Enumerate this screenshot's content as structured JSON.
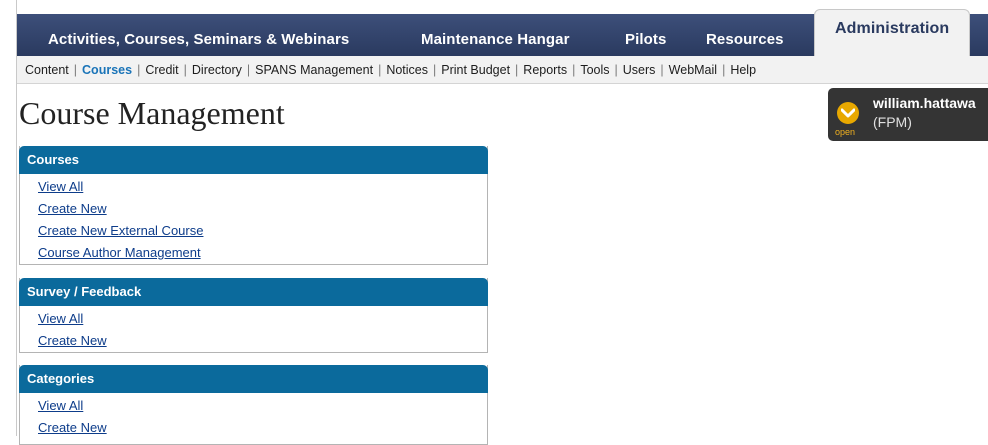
{
  "top_nav": {
    "tabs": [
      {
        "label": "Activities, Courses, Seminars & Webinars"
      },
      {
        "label": "Maintenance Hangar"
      },
      {
        "label": "Pilots"
      },
      {
        "label": "Resources"
      },
      {
        "label": "Administration",
        "active": true
      }
    ]
  },
  "sub_nav": {
    "items": [
      "Content",
      "Courses",
      "Credit",
      "Directory",
      "SPANS Management",
      "Notices",
      "Print Budget",
      "Reports",
      "Tools",
      "Users",
      "WebMail",
      "Help"
    ],
    "separator": "|",
    "current": "Courses"
  },
  "page": {
    "title": "Course Management"
  },
  "user": {
    "name": "william.hattawa",
    "role": "(FPM)",
    "status_label": "open"
  },
  "panels": {
    "courses": {
      "title": "Courses",
      "links": [
        "View All",
        "Create New",
        "Create New External Course",
        "Course Author Management"
      ]
    },
    "survey": {
      "title": "Survey / Feedback",
      "links": [
        "View All",
        "Create New"
      ]
    },
    "categories": {
      "title": "Categories",
      "links": [
        "View All",
        "Create New"
      ]
    }
  },
  "colors": {
    "nav_bg": "#2a3a5f",
    "panel_header": "#0b6a9c",
    "link": "#0d3c8a",
    "current_subnav": "#1a74b8",
    "badge_accent": "#e8a800"
  }
}
